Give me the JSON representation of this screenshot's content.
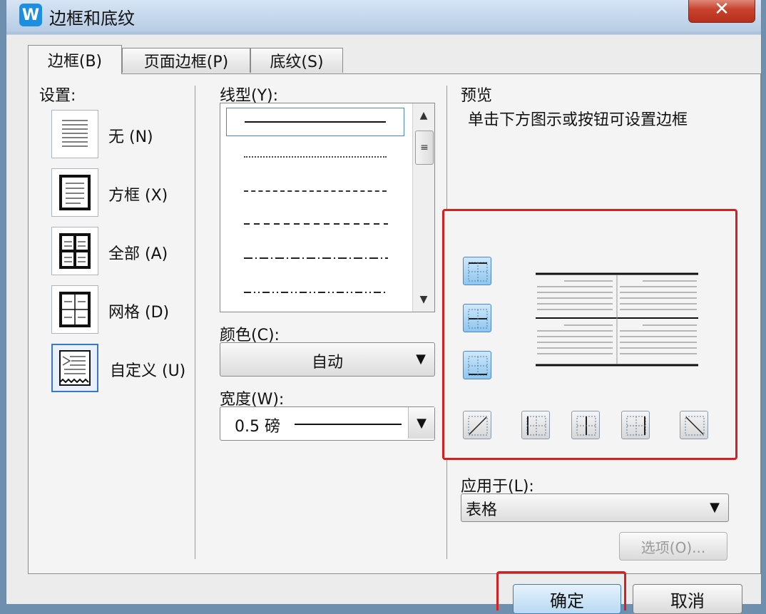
{
  "window": {
    "title": "边框和底纹",
    "app_icon": "W"
  },
  "tabs": [
    {
      "label": "边框(B)",
      "active": true
    },
    {
      "label": "页面边框(P)",
      "active": false
    },
    {
      "label": "底纹(S)",
      "active": false
    }
  ],
  "settings": {
    "heading": "设置:",
    "items": [
      {
        "label": "无 (N)",
        "icon": "no-border-icon"
      },
      {
        "label": "方框 (X)",
        "icon": "box-border-icon"
      },
      {
        "label": "全部 (A)",
        "icon": "all-borders-icon"
      },
      {
        "label": "网格 (D)",
        "icon": "grid-border-icon"
      },
      {
        "label": "自定义 (U)",
        "icon": "custom-border-icon",
        "selected": true
      }
    ]
  },
  "line_style": {
    "heading": "线型(Y):",
    "options": [
      "solid",
      "dotted",
      "dashed-short",
      "dashed",
      "dash-dot",
      "dash-dot-dot"
    ],
    "selected": "solid"
  },
  "color": {
    "label": "颜色(C):",
    "value": "自动"
  },
  "width": {
    "label": "宽度(W):",
    "value": "0.5  磅"
  },
  "preview": {
    "heading": "预览",
    "hint": "单击下方图示或按钮可设置边框"
  },
  "apply_to": {
    "label": "应用于(L):",
    "value": "表格"
  },
  "options_button": "选项(O)...",
  "ok_button": "确定",
  "cancel_button": "取消",
  "colors": {
    "highlight": "#d42020",
    "accent": "#4a86c8"
  }
}
